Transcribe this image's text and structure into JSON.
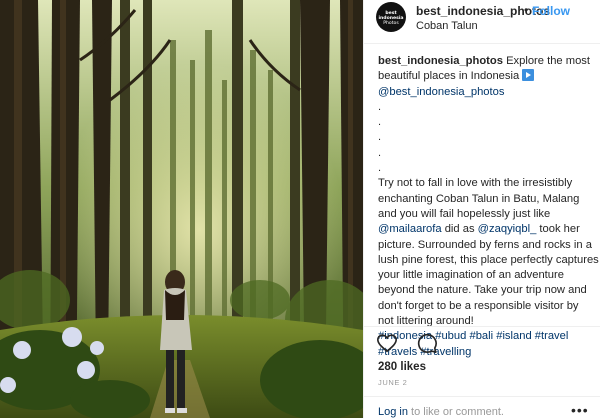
{
  "header": {
    "avatar_text": [
      "best",
      "indonesia",
      "Photos"
    ],
    "username": "best_indonesia_photos",
    "dot": "•",
    "follow_label": "Follow",
    "location": "Coban Talun"
  },
  "caption": {
    "username": "best_indonesia_photos",
    "intro_1": "Explore the most",
    "intro_2": "beautiful places in Indonesia",
    "mention_main": "@best_indonesia_photos",
    "dots": [
      ".",
      ".",
      ".",
      ".",
      "."
    ],
    "body_1": "Try not to fall in love with the irresistibly",
    "body_2": "enchanting Coban Talun in Batu, Malang",
    "body_3": "and you will fail hopelessly just like",
    "mention_1": "@mailaarofa",
    "body_4a": " did as ",
    "mention_2": "@zaqyiqbl_",
    "body_4b": " took her",
    "body_5": "picture. Surrounded by ferns and rocks in a",
    "body_6": "lush pine forest, this place perfectly captures",
    "body_7": "your little imagination of an adventure",
    "body_8": "beyond the nature. Take your trip now and",
    "body_9": "don't forget to be a responsible visitor by",
    "body_10": "not littering around!",
    "hashtags_1": [
      "#indonesia",
      "#ubud",
      "#bali",
      "#island",
      "#travel"
    ],
    "hashtags_2": [
      "#travels",
      "#travelling"
    ]
  },
  "actions": {
    "like_icon": "heart-icon",
    "comment_icon": "comment-icon"
  },
  "likes": "280 likes",
  "date": "JUNE 2",
  "footer": {
    "login_link": "Log in",
    "login_rest": " to like or comment.",
    "more": "•••"
  },
  "colors": {
    "link": "#003569",
    "follow": "#3897f0",
    "muted": "#999999"
  }
}
